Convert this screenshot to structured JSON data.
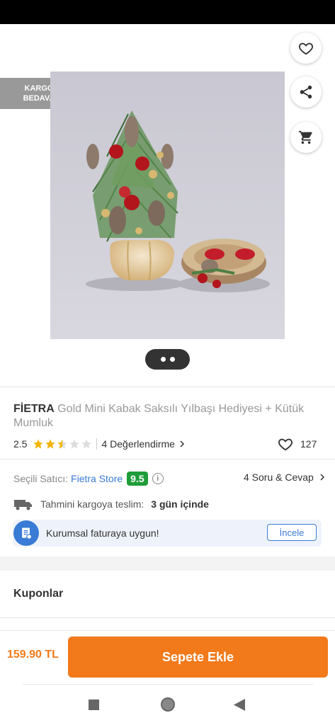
{
  "cargo_badge": {
    "line1": "KARGO",
    "line2": "BEDAVA"
  },
  "product": {
    "brand": "FİETRA",
    "name": "Gold Mini Kabak Saksılı Yılbaşı Hediyesi + Kütük Mumluk",
    "rating": "2.5",
    "rating_value": 2.5,
    "reviews_label": "4 Değerlendirme",
    "likes": "127",
    "images_count": 2,
    "current_image": 1
  },
  "seller": {
    "label": "Seçili Satıcı:",
    "name": "Fietra Store",
    "score": "9.5",
    "qa_label": "4 Soru & Cevap"
  },
  "delivery": {
    "label": "Tahmini kargoya teslim:",
    "value": "3 gün içinde"
  },
  "invoice": {
    "text": "Kurumsal faturaya uygun!",
    "button": "İncele"
  },
  "coupons": {
    "title": "Kuponlar"
  },
  "cart": {
    "price": "159.90 TL",
    "button": "Sepete Ekle"
  },
  "colors": {
    "accent": "#f27a1a",
    "link": "#3a7bd5",
    "score_bg": "#1f9d3a"
  },
  "icons": [
    "back-arrow-icon",
    "heart-icon",
    "share-icon",
    "cart-icon",
    "star-icon",
    "info-icon",
    "truck-icon",
    "invoice-icon",
    "chevron-right-icon",
    "nav-square-icon",
    "nav-circle-icon",
    "nav-triangle-icon"
  ]
}
